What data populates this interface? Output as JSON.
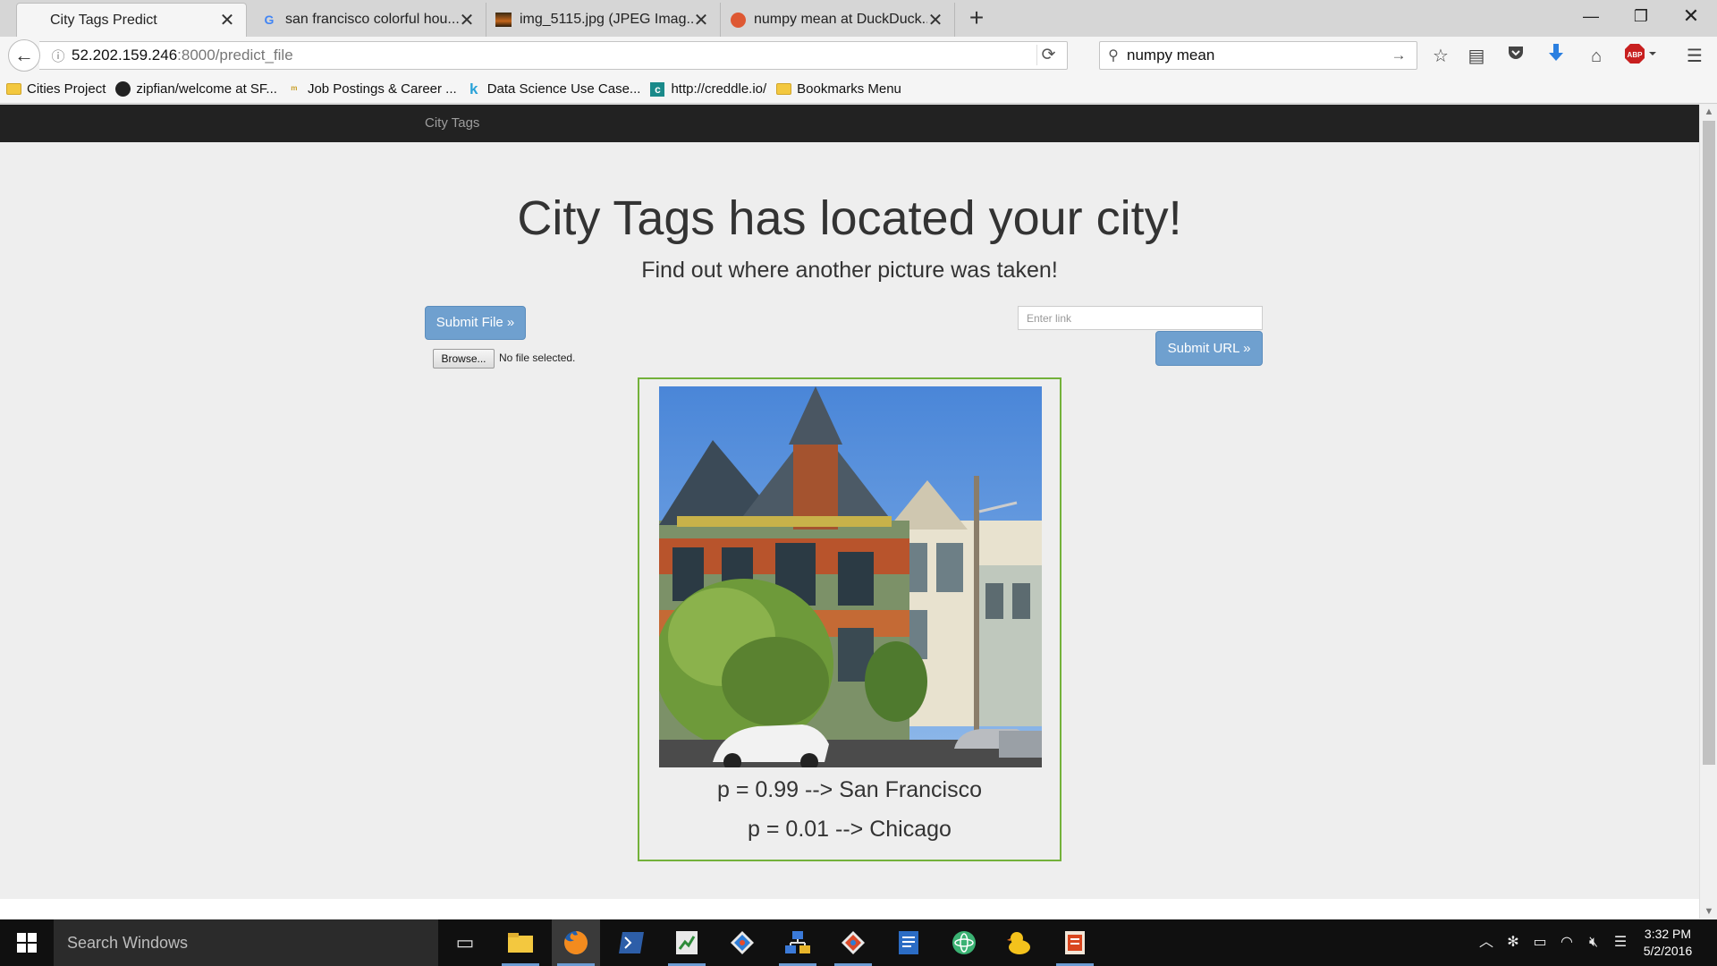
{
  "browser": {
    "tabs": [
      {
        "title": "City Tags Predict",
        "icon": "blank-page-icon"
      },
      {
        "title": "san francisco colorful hou...",
        "icon": "google-icon"
      },
      {
        "title": "img_5115.jpg (JPEG Imag...",
        "icon": "image-thumbnail-icon"
      },
      {
        "title": "numpy mean at DuckDuck...",
        "icon": "duckduckgo-icon"
      }
    ],
    "address": {
      "host": "52.202.159.246",
      "path": ":8000/predict_file"
    },
    "search": {
      "value": "numpy mean"
    },
    "bookmarks": [
      {
        "label": "Cities Project",
        "icon": "folder-icon"
      },
      {
        "label": "zipfian/welcome at SF...",
        "icon": "github-icon"
      },
      {
        "label": "Job Postings & Career ...",
        "icon": "site-icon"
      },
      {
        "label": "Data Science Use Case...",
        "icon": "k-icon"
      },
      {
        "label": "http://creddle.io/",
        "icon": "c-icon"
      },
      {
        "label": "Bookmarks Menu",
        "icon": "folder-icon"
      }
    ]
  },
  "page": {
    "brand": "City Tags",
    "title": "City Tags has located your city!",
    "subtitle": "Find out where another picture was taken!",
    "submit_file_label": "Submit File »",
    "browse_label": "Browse...",
    "no_file_label": "No file selected.",
    "link_placeholder": "Enter link",
    "submit_url_label": "Submit URL »",
    "predictions": [
      {
        "text": "p = 0.99 --> San Francisco"
      },
      {
        "text": "p = 0.01 --> Chicago"
      }
    ],
    "accent_color": "#73b13a",
    "button_color": "#6fa0cf"
  },
  "taskbar": {
    "search_label": "Search Windows",
    "time": "3:32 PM",
    "date": "5/2/2016"
  }
}
